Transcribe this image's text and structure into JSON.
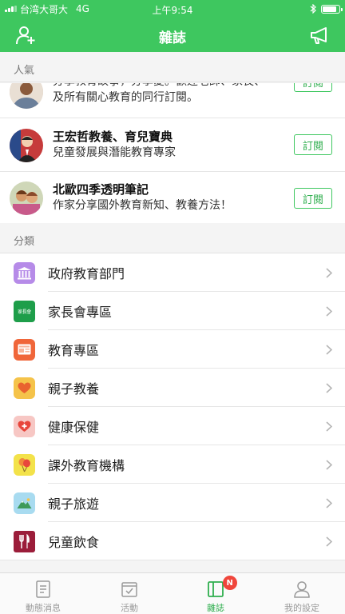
{
  "status_bar": {
    "carrier": "台湾大哥大",
    "network": "4G",
    "time": "上午9:54",
    "battery_level": 0.85
  },
  "header": {
    "title": "雜誌",
    "left_icon": "add-user-icon",
    "right_icon": "megaphone-icon"
  },
  "popular": {
    "label": "人氣",
    "items": [
      {
        "name": "",
        "desc_line1": "分享教育故事，分享愛。歡迎老師、家長、",
        "desc_line2": "及所有關心教育的同行訂閱。",
        "button": "訂閱"
      },
      {
        "name": "王宏哲教養、育兒寶典",
        "desc": "兒童發展與潛能教育專家",
        "button": "訂閱"
      },
      {
        "name": "北歐四季透明筆記",
        "desc": "作家分享國外教育新知、教養方法！",
        "button": "訂閱"
      }
    ]
  },
  "categories": {
    "label": "分類",
    "items": [
      {
        "label": "政府教育部門",
        "icon": "government-building-icon",
        "color": "#b68be8"
      },
      {
        "label": "家長會專區",
        "icon": "parents-association-icon",
        "color": "#1e9e4a",
        "icon_text": "家長會"
      },
      {
        "label": "教育專區",
        "icon": "education-tablet-icon",
        "color": "#f0663a"
      },
      {
        "label": "親子教養",
        "icon": "heart-icon",
        "color": "#f5c34a"
      },
      {
        "label": "健康保健",
        "icon": "health-heart-plus-icon",
        "color": "#f7c7c4"
      },
      {
        "label": "課外教育機構",
        "icon": "balloon-icon",
        "color": "#f3e24a"
      },
      {
        "label": "親子旅遊",
        "icon": "mountain-travel-icon",
        "color": "#a8dbf0"
      },
      {
        "label": "兒童飲食",
        "icon": "fork-knife-icon",
        "color": "#9b1d3a"
      }
    ]
  },
  "tabbar": {
    "tabs": [
      {
        "label": "動態消息",
        "icon": "news-feed-icon",
        "active": false
      },
      {
        "label": "活動",
        "icon": "activity-checkbox-icon",
        "active": false
      },
      {
        "label": "雜誌",
        "icon": "magazine-icon",
        "active": true,
        "badge": "N"
      },
      {
        "label": "我的設定",
        "icon": "profile-icon",
        "active": false
      }
    ]
  },
  "colors": {
    "brand_green": "#3ec75f",
    "badge_red": "#f0463c"
  }
}
